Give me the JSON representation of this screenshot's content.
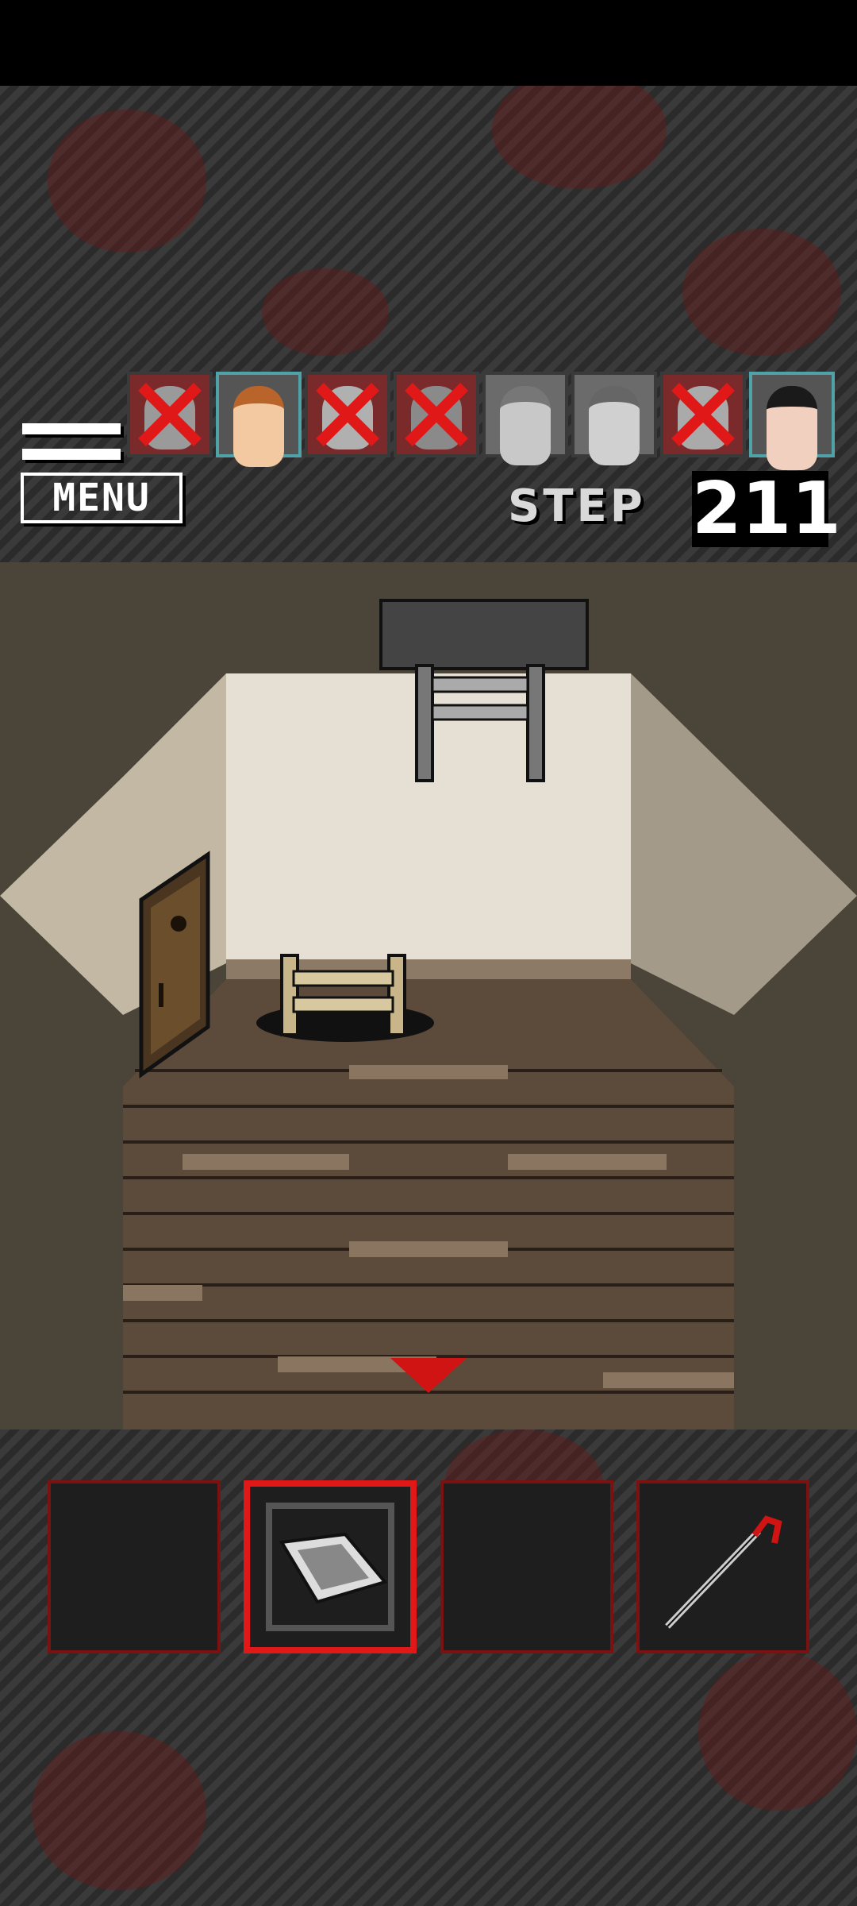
{
  "hud": {
    "menu_label": "MENU",
    "step_label": "STEP",
    "step_count": "211"
  },
  "characters": [
    {
      "status": "dead"
    },
    {
      "status": "alive"
    },
    {
      "status": "dead"
    },
    {
      "status": "dead"
    },
    {
      "status": "inactive"
    },
    {
      "status": "inactive"
    },
    {
      "status": "dead"
    },
    {
      "status": "alive"
    }
  ],
  "scene": {
    "objects": [
      "ceiling-ladder",
      "floor-ladder-hole",
      "wooden-door",
      "down-arrow"
    ]
  },
  "inventory": {
    "slots": [
      {
        "item": "empty",
        "selected": false
      },
      {
        "item": "photo-card",
        "selected": true
      },
      {
        "item": "empty",
        "selected": false
      },
      {
        "item": "hook-pole",
        "selected": false
      }
    ]
  },
  "colors": {
    "accent_red": "#e01818",
    "dead_x": "#e01818",
    "alive_border": "#4fa3a8"
  }
}
